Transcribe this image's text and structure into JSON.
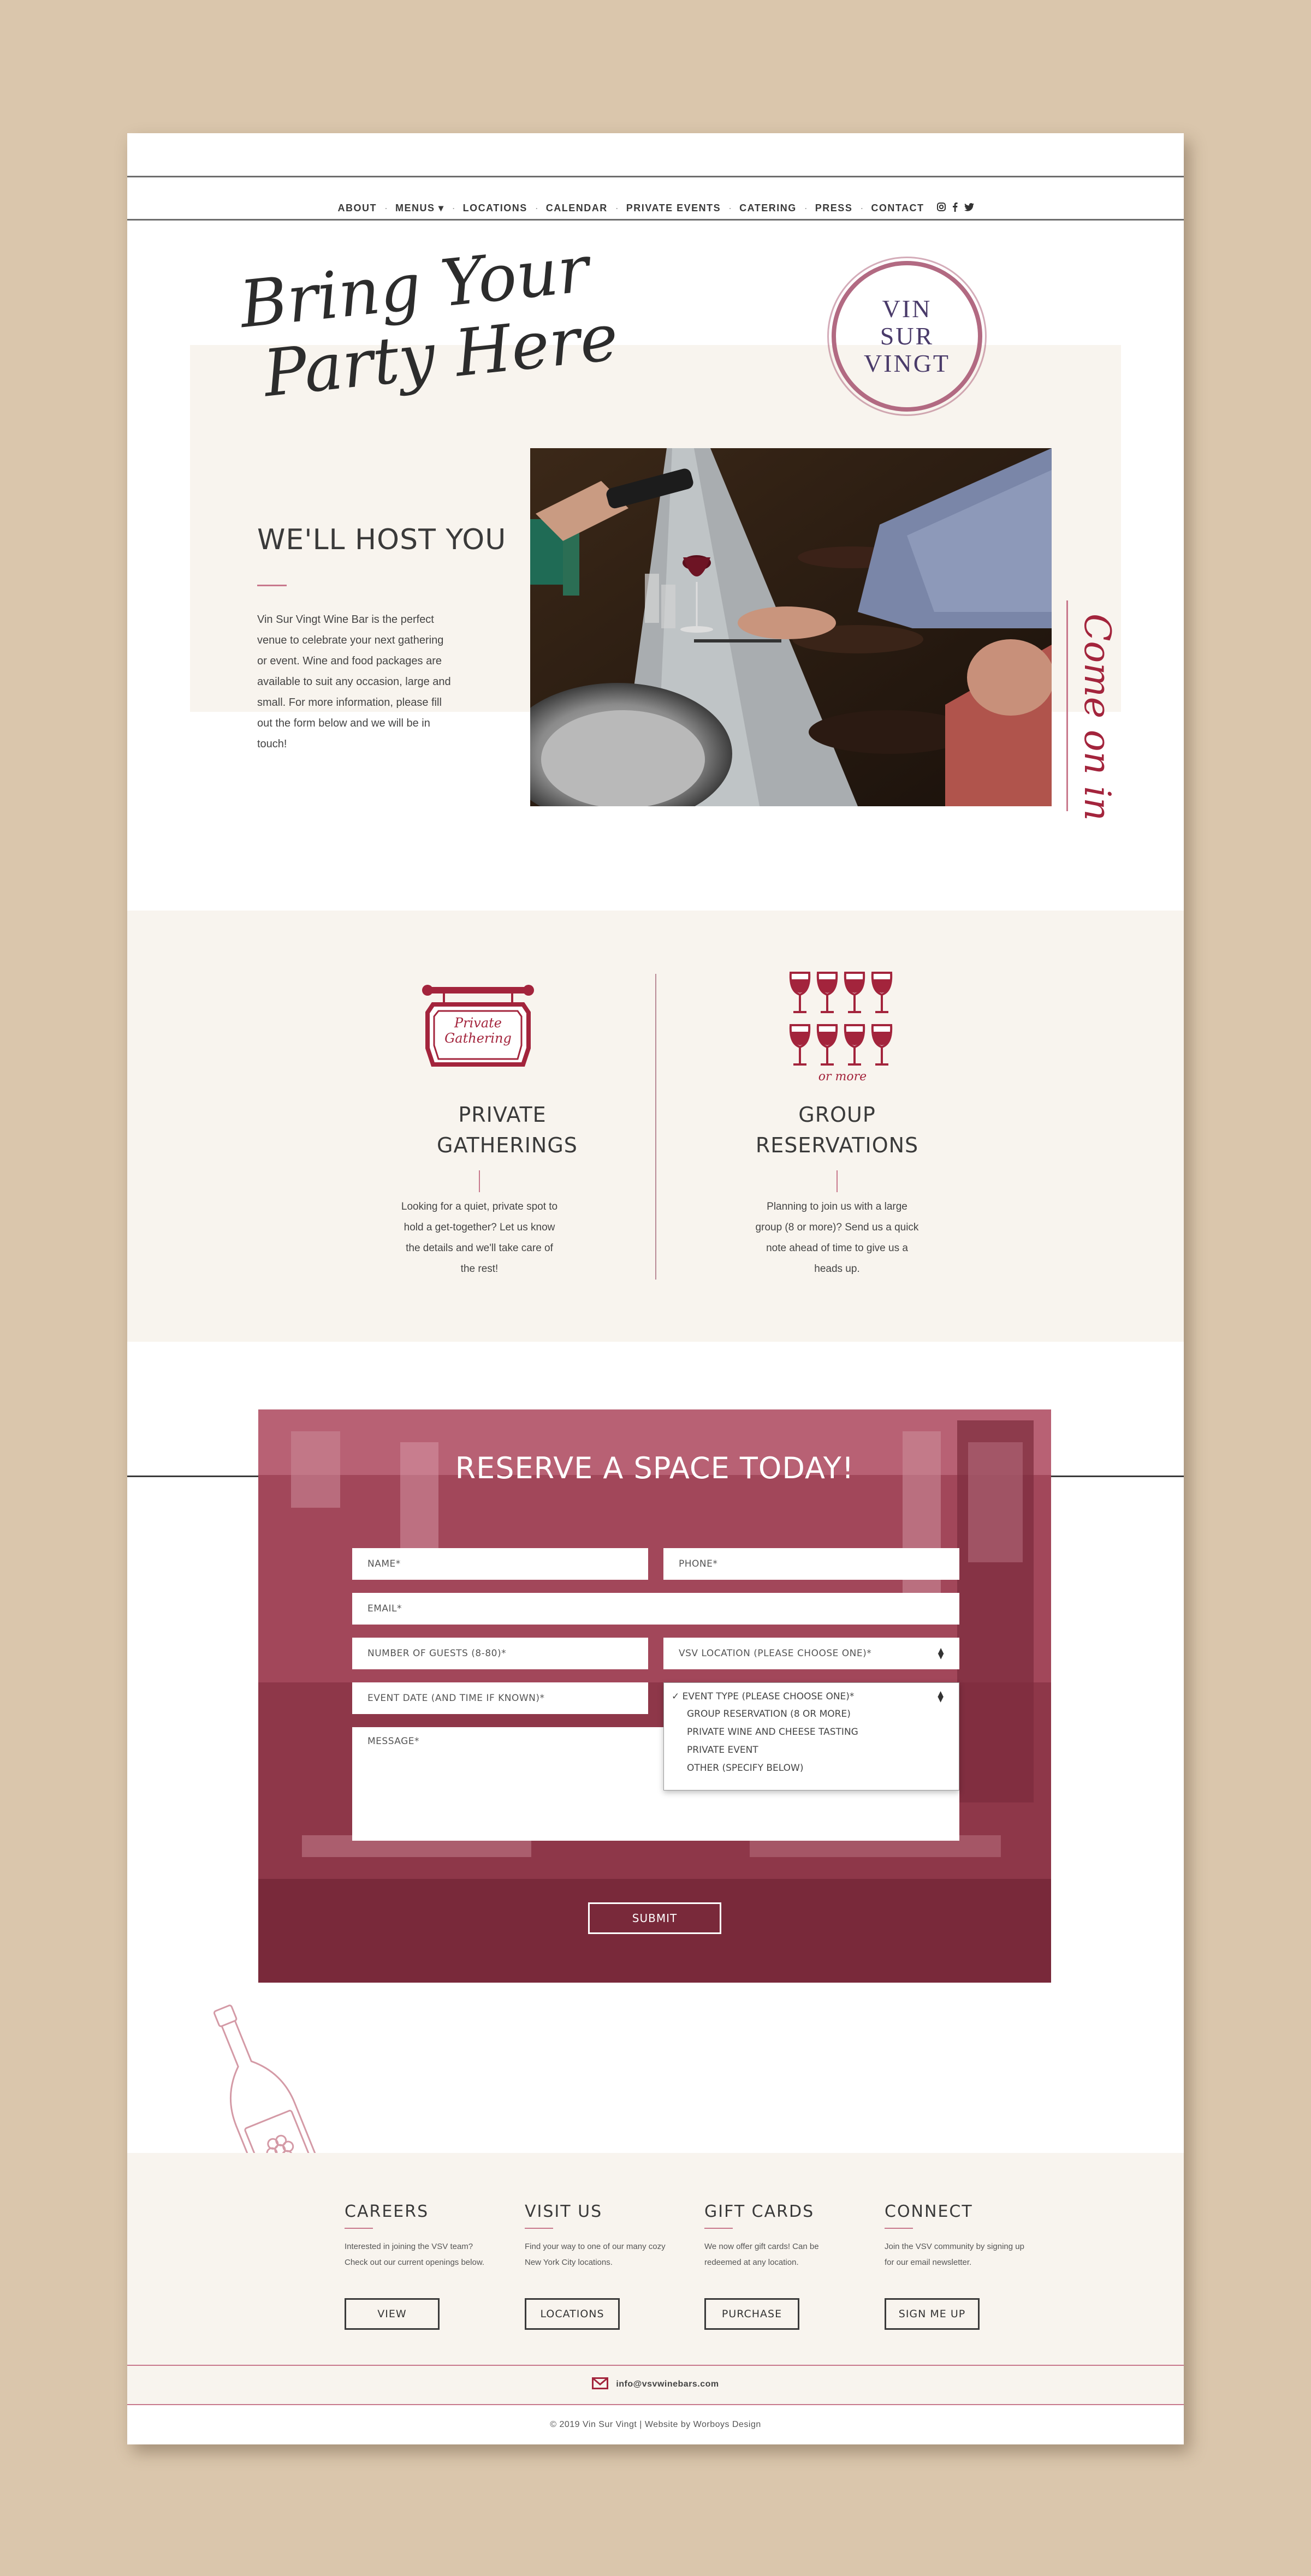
{
  "nav": {
    "items": [
      "ABOUT",
      "MENUS",
      "LOCATIONS",
      "CALENDAR",
      "PRIVATE EVENTS",
      "CATERING",
      "PRESS",
      "CONTACT"
    ],
    "social_icons": [
      "instagram-icon",
      "facebook-icon",
      "twitter-icon"
    ]
  },
  "hero": {
    "script_line1": "Bring Your",
    "script_line2": "Party Here",
    "logo_line1": "VIN",
    "logo_line2": "SUR",
    "logo_line3": "VINGT",
    "heading": "WE'LL HOST YOU",
    "body": "Vin Sur Vingt Wine Bar is the perfect venue to celebrate your next gathering or event.  Wine and food packages are available to suit any occasion, large and small. For more information, please fill out the form below and we will be in touch!",
    "side_script": "Come on in"
  },
  "services": {
    "private": {
      "sign_line1": "Private",
      "sign_line2": "Gathering",
      "title_line1": "PRIVATE",
      "title_line2": "GATHERINGS",
      "body": "Looking for a quiet, private spot to hold a get-together? Let us know the details and we'll take care of the rest!"
    },
    "group": {
      "icon_caption": "or more",
      "title_line1": "GROUP",
      "title_line2": "RESERVATIONS",
      "body": "Planning to join us with a large group (8 or more)? Send us a quick note ahead of time to give us a heads up."
    }
  },
  "form": {
    "title": "RESERVE A SPACE TODAY!",
    "name_placeholder": "NAME*",
    "phone_placeholder": "PHONE*",
    "email_placeholder": "EMAIL*",
    "guests_placeholder": "NUMBER OF GUESTS (8-80)*",
    "location_placeholder": "VSV LOCATION (PLEASE CHOOSE ONE)*",
    "date_placeholder": "EVENT DATE (AND TIME IF KNOWN)*",
    "message_placeholder": "MESSAGE*",
    "event_type_options": [
      "EVENT TYPE (PLEASE CHOOSE ONE)*",
      "GROUP RESERVATION (8 OR MORE)",
      "PRIVATE WINE AND CHEESE TASTING",
      "PRIVATE EVENT",
      "OTHER (SPECIFY BELOW)"
    ],
    "submit_label": "SUBMIT"
  },
  "footer": {
    "columns": [
      {
        "title": "CAREERS",
        "body": "Interested in joining the VSV team? Check out our current openings below.",
        "button": "VIEW"
      },
      {
        "title": "VISIT US",
        "body": "Find your way to one of our many cozy New York City locations.",
        "button": "LOCATIONS"
      },
      {
        "title": "GIFT CARDS",
        "body": "We now offer gift cards! Can be redeemed at any location.",
        "button": "PURCHASE"
      },
      {
        "title": "CONNECT",
        "body": "Join the VSV community by signing up for our email newsletter.",
        "button": "SIGN ME UP"
      }
    ],
    "email": "info@vsvwinebars.com",
    "copyright": "© 2019 Vin Sur Vingt | Website by Worboys Design"
  },
  "colors": {
    "page_bg": "#dac6ac",
    "beige": "#f8f4ee",
    "wine": "#a3243c",
    "rose": "#c8788c",
    "text": "#3a3a3a"
  }
}
